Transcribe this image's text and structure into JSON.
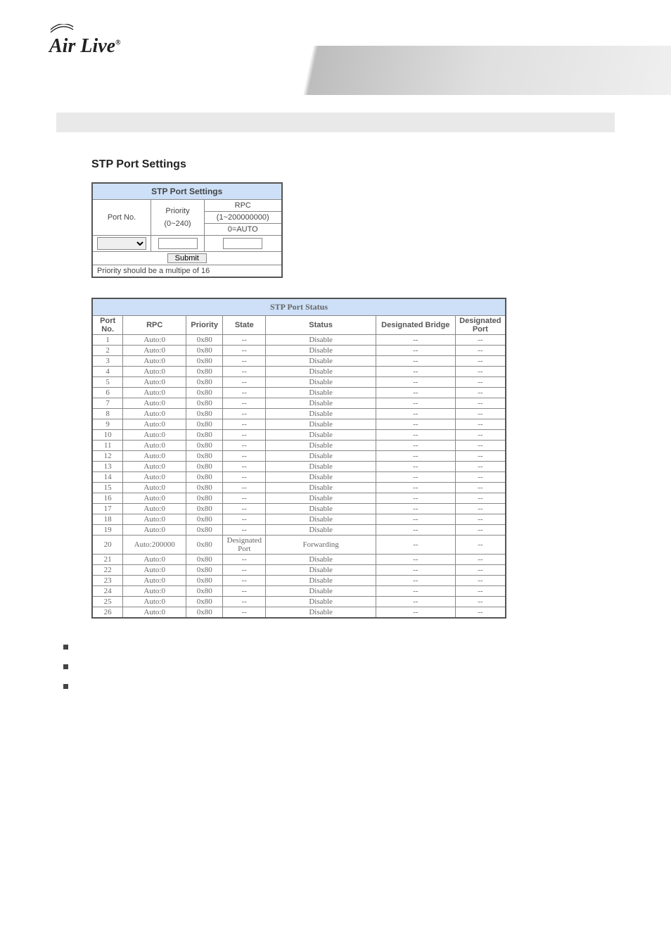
{
  "logo": {
    "text": "Air Live",
    "registered": "®"
  },
  "section_title": "STP Port Settings",
  "settings": {
    "header": "STP Port Settings",
    "columns": {
      "port_no": "Port No.",
      "priority_line1": "Priority",
      "priority_line2": "(0~240)",
      "rpc_line1": "RPC",
      "rpc_line2": "(1~200000000)",
      "rpc_line3": "0=AUTO"
    },
    "submit_label": "Submit",
    "note": "Priority should be a multipe of 16"
  },
  "status": {
    "header": "STP Port Status",
    "columns": {
      "port_no": "Port No.",
      "rpc": "RPC",
      "priority": "Priority",
      "state": "State",
      "status": "Status",
      "dbridge": "Designated Bridge",
      "dport": "Designated Port"
    },
    "rows": [
      {
        "port": "1",
        "rpc": "Auto:0",
        "prio": "0x80",
        "state": "--",
        "status": "Disable",
        "db": "--",
        "dp": "--"
      },
      {
        "port": "2",
        "rpc": "Auto:0",
        "prio": "0x80",
        "state": "--",
        "status": "Disable",
        "db": "--",
        "dp": "--"
      },
      {
        "port": "3",
        "rpc": "Auto:0",
        "prio": "0x80",
        "state": "--",
        "status": "Disable",
        "db": "--",
        "dp": "--"
      },
      {
        "port": "4",
        "rpc": "Auto:0",
        "prio": "0x80",
        "state": "--",
        "status": "Disable",
        "db": "--",
        "dp": "--"
      },
      {
        "port": "5",
        "rpc": "Auto:0",
        "prio": "0x80",
        "state": "--",
        "status": "Disable",
        "db": "--",
        "dp": "--"
      },
      {
        "port": "6",
        "rpc": "Auto:0",
        "prio": "0x80",
        "state": "--",
        "status": "Disable",
        "db": "--",
        "dp": "--"
      },
      {
        "port": "7",
        "rpc": "Auto:0",
        "prio": "0x80",
        "state": "--",
        "status": "Disable",
        "db": "--",
        "dp": "--"
      },
      {
        "port": "8",
        "rpc": "Auto:0",
        "prio": "0x80",
        "state": "--",
        "status": "Disable",
        "db": "--",
        "dp": "--"
      },
      {
        "port": "9",
        "rpc": "Auto:0",
        "prio": "0x80",
        "state": "--",
        "status": "Disable",
        "db": "--",
        "dp": "--"
      },
      {
        "port": "10",
        "rpc": "Auto:0",
        "prio": "0x80",
        "state": "--",
        "status": "Disable",
        "db": "--",
        "dp": "--"
      },
      {
        "port": "11",
        "rpc": "Auto:0",
        "prio": "0x80",
        "state": "--",
        "status": "Disable",
        "db": "--",
        "dp": "--"
      },
      {
        "port": "12",
        "rpc": "Auto:0",
        "prio": "0x80",
        "state": "--",
        "status": "Disable",
        "db": "--",
        "dp": "--"
      },
      {
        "port": "13",
        "rpc": "Auto:0",
        "prio": "0x80",
        "state": "--",
        "status": "Disable",
        "db": "--",
        "dp": "--"
      },
      {
        "port": "14",
        "rpc": "Auto:0",
        "prio": "0x80",
        "state": "--",
        "status": "Disable",
        "db": "--",
        "dp": "--"
      },
      {
        "port": "15",
        "rpc": "Auto:0",
        "prio": "0x80",
        "state": "--",
        "status": "Disable",
        "db": "--",
        "dp": "--"
      },
      {
        "port": "16",
        "rpc": "Auto:0",
        "prio": "0x80",
        "state": "--",
        "status": "Disable",
        "db": "--",
        "dp": "--"
      },
      {
        "port": "17",
        "rpc": "Auto:0",
        "prio": "0x80",
        "state": "--",
        "status": "Disable",
        "db": "--",
        "dp": "--"
      },
      {
        "port": "18",
        "rpc": "Auto:0",
        "prio": "0x80",
        "state": "--",
        "status": "Disable",
        "db": "--",
        "dp": "--"
      },
      {
        "port": "19",
        "rpc": "Auto:0",
        "prio": "0x80",
        "state": "--",
        "status": "Disable",
        "db": "--",
        "dp": "--"
      },
      {
        "port": "20",
        "rpc": "Auto:200000",
        "prio": "0x80",
        "state": "Designated Port",
        "status": "Forwarding",
        "db": "--",
        "dp": "--"
      },
      {
        "port": "21",
        "rpc": "Auto:0",
        "prio": "0x80",
        "state": "--",
        "status": "Disable",
        "db": "--",
        "dp": "--"
      },
      {
        "port": "22",
        "rpc": "Auto:0",
        "prio": "0x80",
        "state": "--",
        "status": "Disable",
        "db": "--",
        "dp": "--"
      },
      {
        "port": "23",
        "rpc": "Auto:0",
        "prio": "0x80",
        "state": "--",
        "status": "Disable",
        "db": "--",
        "dp": "--"
      },
      {
        "port": "24",
        "rpc": "Auto:0",
        "prio": "0x80",
        "state": "--",
        "status": "Disable",
        "db": "--",
        "dp": "--"
      },
      {
        "port": "25",
        "rpc": "Auto:0",
        "prio": "0x80",
        "state": "--",
        "status": "Disable",
        "db": "--",
        "dp": "--"
      },
      {
        "port": "26",
        "rpc": "Auto:0",
        "prio": "0x80",
        "state": "--",
        "status": "Disable",
        "db": "--",
        "dp": "--"
      }
    ]
  },
  "bullets": [
    "",
    "",
    ""
  ]
}
